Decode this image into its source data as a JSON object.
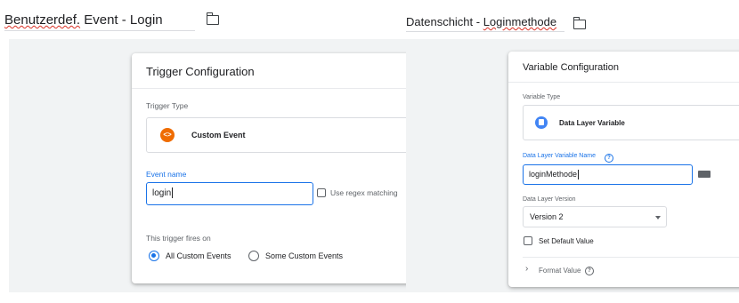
{
  "left": {
    "name_prefix": "Benutzerdef.",
    "name_rest": " Event - Login",
    "card_title": "Trigger Configuration",
    "trigger_type_label": "Trigger Type",
    "trigger_type_value": "Custom Event",
    "event_name_label": "Event name",
    "event_name_value": "login",
    "regex_label": "Use regex matching",
    "fires_on_label": "This trigger fires on",
    "radio_all": "All Custom Events",
    "radio_some": "Some Custom Events"
  },
  "right": {
    "name_prefix": "Datenschicht - ",
    "name_rest": "Loginmethode",
    "card_title": "Variable Configuration",
    "variable_type_label": "Variable Type",
    "variable_type_value": "Data Layer Variable",
    "dlv_name_label": "Data Layer Variable Name",
    "dlv_name_value": "loginMethode",
    "version_label": "Data Layer Version",
    "version_value": "Version 2",
    "default_value_label": "Set Default Value",
    "format_value_label": "Format Value"
  },
  "colors": {
    "accent": "#1a73e8",
    "custom_event_icon": "#ef6c00",
    "dlv_icon": "#4285f4",
    "canvas": "#f1f3f4"
  },
  "icons": {
    "folder": "folder-icon",
    "custom_event": "custom-event-icon",
    "dlv": "data-layer-icon",
    "help": "help-icon",
    "variable_picker": "variable-picker-icon"
  }
}
